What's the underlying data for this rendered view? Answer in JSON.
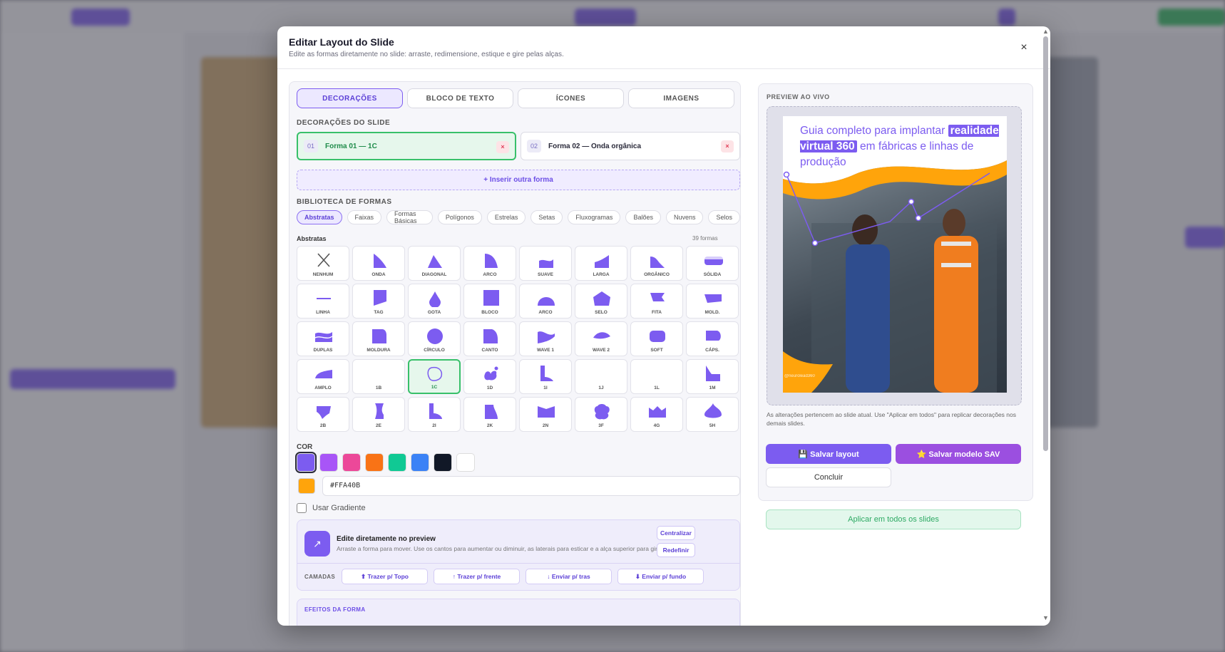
{
  "modal": {
    "title": "Editar Layout do Slide",
    "subtitle": "Edite as formas diretamente no slide: arraste, redimensione, estique e gire pelas alças.",
    "close_icon": "×"
  },
  "tabs": [
    {
      "label": "DECORAÇÕES",
      "active": true
    },
    {
      "label": "BLOCO DE TEXTO",
      "active": false
    },
    {
      "label": "ÍCONES",
      "active": false
    },
    {
      "label": "IMAGENS",
      "active": false
    }
  ],
  "decorations": {
    "heading": "DECORAÇÕES DO SLIDE",
    "items": [
      {
        "num": "01",
        "label": "Forma 01 — 1C",
        "remove": "×",
        "active": true
      },
      {
        "num": "02",
        "label": "Forma 02 — Onda orgânica",
        "remove": "×",
        "active": false
      }
    ],
    "insert_label": "+ Inserir outra forma"
  },
  "library": {
    "heading": "BIBLIOTECA DE FORMAS",
    "categories": [
      "Abstratas",
      "Faixas",
      "Formas Básicas",
      "Polígonos",
      "Estrelas",
      "Setas",
      "Fluxogramas",
      "Balões",
      "Nuvens",
      "Selos"
    ],
    "active_category": "Abstratas",
    "section_label": "Abstratas",
    "count": "39 formas",
    "shapes": [
      "NENHUM",
      "ONDA",
      "DIAGONAL",
      "ARCO",
      "SUAVE",
      "LARGA",
      "ORGÂNICO",
      "SÓLIDA",
      "LINHA",
      "TAG",
      "GOTA",
      "BLOCO",
      "ARCO",
      "SELO",
      "FITA",
      "MOLD.",
      "DUPLAS",
      "MOLDURA",
      "CÍRCULO",
      "CANTO",
      "WAVE 1",
      "WAVE 2",
      "SOFT",
      "CÁPS.",
      "AMPLO",
      "1B",
      "1C",
      "1D",
      "1I",
      "1J",
      "1L",
      "1M",
      "2B",
      "2E",
      "2I",
      "2K",
      "2N",
      "3F",
      "4G",
      "5H"
    ],
    "selected_shape": "1C"
  },
  "color": {
    "heading": "COR",
    "swatches": [
      "#7c5cf0",
      "#a855f7",
      "#ec4899",
      "#f97316",
      "#10c994",
      "#3b82f6",
      "#111827",
      "#ffffff"
    ],
    "active_swatch": "#7c5cf0",
    "hex_value": "#FFA40B",
    "gradient_label": "Usar Gradiente",
    "accent": "#7c5cf0"
  },
  "edit": {
    "title": "Edite diretamente no preview",
    "desc": "Arraste a forma para mover. Use os cantos para aumentar ou diminuir, as laterais para esticar e a alça superior para girar.",
    "center_btn": "Centralizar",
    "reset_btn": "Redefinir",
    "icon": "↗",
    "layers_label": "CAMADAS",
    "layers": [
      "⬆ Trazer p/ Topo",
      "↑ Trazer p/ frente",
      "↓ Enviar p/ tras",
      "⬇ Enviar p/ fundo"
    ]
  },
  "effects": {
    "heading": "EFEITOS DA FORMA"
  },
  "preview": {
    "heading": "PREVIEW AO VIVO",
    "slide_title_pre": "Guia completo para implantar",
    "slide_title_hl": "realidade virtual 360",
    "slide_title_post": "em fábricas e linhas de produção",
    "slide_handle": "@neurolead360",
    "note": "As alterações pertencem ao slide atual. Use \"Aplicar em todos\" para replicar decorações nos demais slides.",
    "save_layout": "💾 Salvar layout",
    "save_model": "⭐ Salvar modelo SAV",
    "finish": "Concluir",
    "apply_all": "Aplicar em todos os slides"
  }
}
